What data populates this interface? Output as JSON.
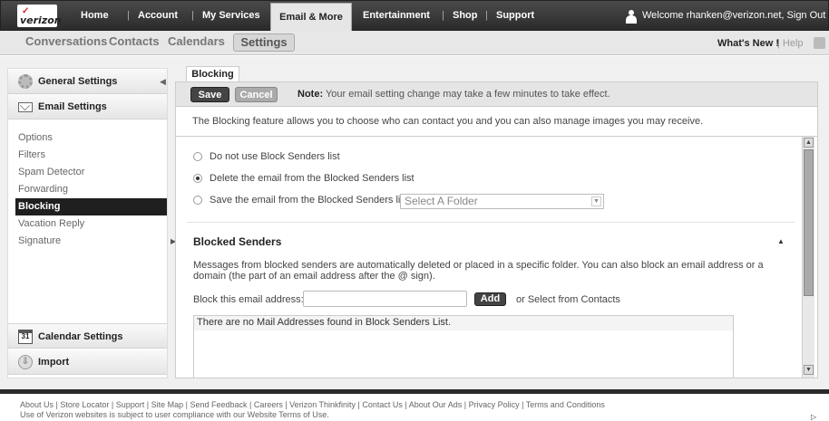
{
  "header": {
    "logo_text": "verizon",
    "logo_check": "✓",
    "nav": [
      "Home",
      "Account",
      "My Services",
      "Email & More",
      "Entertainment",
      "Shop",
      "Support"
    ],
    "nav_separator": "|",
    "welcome": "Welcome rhanken@verizon.net, Sign Out"
  },
  "subnav": {
    "items": [
      "Conversations",
      "Contacts",
      "Calendars",
      "Settings"
    ],
    "whats_new": "What's New !",
    "help": "| Help"
  },
  "sidebar": {
    "general_settings": "General Settings",
    "email_settings": "Email Settings",
    "email_items": [
      "Options",
      "Filters",
      "Spam Detector",
      "Forwarding",
      "Blocking",
      "Vacation Reply",
      "Signature"
    ],
    "active_item": "Blocking",
    "calendar_settings": "Calendar Settings",
    "calendar_icon_text": "31",
    "import": "Import"
  },
  "content": {
    "tab": "Blocking",
    "save": "Save",
    "cancel": "Cancel",
    "note_label": "Note:",
    "note_text": " Your email setting change may take a few minutes to take effect.",
    "info": "The Blocking feature allows you to choose who can contact you and you can also manage images you may receive.",
    "options": [
      {
        "label": "Do not use Block Senders list",
        "selected": false
      },
      {
        "label": "Delete the email from the Blocked Senders list",
        "selected": true
      },
      {
        "label": "Save the email from the Blocked Senders list",
        "selected": false
      }
    ],
    "folder_select": "Select A Folder",
    "blocked_title": "Blocked Senders",
    "blocked_desc": "Messages from blocked senders are automatically deleted or placed in a specific folder. You can also block an email address or a domain (the part of an email address after the @ sign).",
    "block_label": "Block this email address:",
    "block_input_value": "",
    "add": "Add",
    "or_contacts": "or  Select from Contacts",
    "empty_list": "There are no Mail Addresses found in Block Senders List."
  },
  "footer": {
    "links": "About Us | Store Locator | Support | Site Map | Send Feedback | Careers | Verizon Thinkfinity | Contact Us | About Our Ads | Privacy Policy | Terms and Conditions",
    "legal": "Use of Verizon websites is subject to user compliance with our Website Terms of Use."
  },
  "colors": {
    "top_bar": "#2b2b2b",
    "active_sidebar": "#1f1f1f",
    "brand_red": "#dd2222"
  }
}
